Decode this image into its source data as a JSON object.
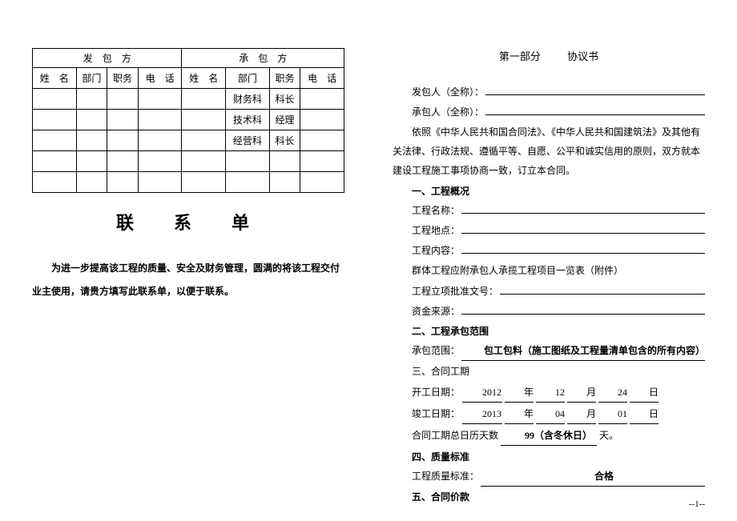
{
  "left": {
    "table": {
      "groupA": "发　包　方",
      "groupB": "承　包　方",
      "cols": {
        "name": "姓　名",
        "dept": "部门",
        "role": "职务",
        "phone": "电　话"
      },
      "rows": [
        {
          "b_dept": "财务科",
          "b_role": "科长"
        },
        {
          "b_dept": "技术科",
          "b_role": "经理"
        },
        {
          "b_dept": "经营科",
          "b_role": "科长"
        },
        {
          "b_dept": "",
          "b_role": ""
        },
        {
          "b_dept": "",
          "b_role": ""
        }
      ]
    },
    "title": "联　系　单",
    "intro": "为进一步提高该工程的质量、安全及财务管理，圆满的将该工程交付业主使用，请贵方填写此联系单，以便于联系。"
  },
  "right": {
    "partNum": "第一部分",
    "partTitle": "协议书",
    "contractorFull": "发包人（全称）：",
    "subcontractorFull": "承包人（全称）：",
    "basis": "依照《中华人民共和国合同法》、《中华人民共和国建筑法》及其他有关法律、行政法规、遵循平等、自愿、公平和诚实信用的原则，双方就本建设工程施工事项协商一致，订立本合同。",
    "s1": "一、工程概况",
    "projName": "工程名称：",
    "projAddr": "工程地点：",
    "projContent": "工程内容：",
    "groupNote": "群体工程应附承包人承揽工程项目一览表（附件）",
    "approvalDoc": "工程立项批准文号：",
    "fundSource": "资金来源：",
    "s2": "二、工程承包范围",
    "scopeLabel": "承包范围：",
    "scopeValue": "包工包料（施工图纸及工程量清单包含的所有内容）",
    "s3": "三、合同工期",
    "startLabel": "开工日期：",
    "startY": "2012",
    "startM": "12",
    "startD": "24",
    "endLabel": "竣工日期：",
    "endY": "2013",
    "endM": "04",
    "endD": "01",
    "yearUnit": "年",
    "monthUnit": "月",
    "dayUnit": "日",
    "durationLabel": "合同工期总日历天数",
    "durationValue": "99（含冬休日）",
    "durationUnit": "天。",
    "s4": "四、质量标准",
    "qualityLabel": "工程质量标准：",
    "qualityValue": "合格",
    "s5": "五、合同价款",
    "pageNum": "--1--"
  }
}
